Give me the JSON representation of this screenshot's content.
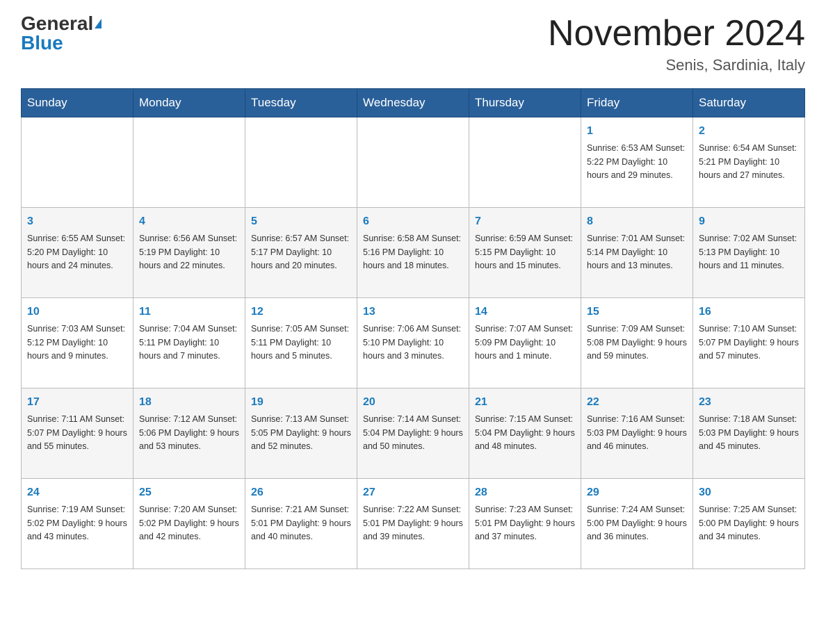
{
  "header": {
    "logo_general": "General",
    "logo_blue": "Blue",
    "month_title": "November 2024",
    "location": "Senis, Sardinia, Italy"
  },
  "days_of_week": [
    "Sunday",
    "Monday",
    "Tuesday",
    "Wednesday",
    "Thursday",
    "Friday",
    "Saturday"
  ],
  "weeks": [
    [
      {
        "day": "",
        "info": ""
      },
      {
        "day": "",
        "info": ""
      },
      {
        "day": "",
        "info": ""
      },
      {
        "day": "",
        "info": ""
      },
      {
        "day": "",
        "info": ""
      },
      {
        "day": "1",
        "info": "Sunrise: 6:53 AM\nSunset: 5:22 PM\nDaylight: 10 hours\nand 29 minutes."
      },
      {
        "day": "2",
        "info": "Sunrise: 6:54 AM\nSunset: 5:21 PM\nDaylight: 10 hours\nand 27 minutes."
      }
    ],
    [
      {
        "day": "3",
        "info": "Sunrise: 6:55 AM\nSunset: 5:20 PM\nDaylight: 10 hours\nand 24 minutes."
      },
      {
        "day": "4",
        "info": "Sunrise: 6:56 AM\nSunset: 5:19 PM\nDaylight: 10 hours\nand 22 minutes."
      },
      {
        "day": "5",
        "info": "Sunrise: 6:57 AM\nSunset: 5:17 PM\nDaylight: 10 hours\nand 20 minutes."
      },
      {
        "day": "6",
        "info": "Sunrise: 6:58 AM\nSunset: 5:16 PM\nDaylight: 10 hours\nand 18 minutes."
      },
      {
        "day": "7",
        "info": "Sunrise: 6:59 AM\nSunset: 5:15 PM\nDaylight: 10 hours\nand 15 minutes."
      },
      {
        "day": "8",
        "info": "Sunrise: 7:01 AM\nSunset: 5:14 PM\nDaylight: 10 hours\nand 13 minutes."
      },
      {
        "day": "9",
        "info": "Sunrise: 7:02 AM\nSunset: 5:13 PM\nDaylight: 10 hours\nand 11 minutes."
      }
    ],
    [
      {
        "day": "10",
        "info": "Sunrise: 7:03 AM\nSunset: 5:12 PM\nDaylight: 10 hours\nand 9 minutes."
      },
      {
        "day": "11",
        "info": "Sunrise: 7:04 AM\nSunset: 5:11 PM\nDaylight: 10 hours\nand 7 minutes."
      },
      {
        "day": "12",
        "info": "Sunrise: 7:05 AM\nSunset: 5:11 PM\nDaylight: 10 hours\nand 5 minutes."
      },
      {
        "day": "13",
        "info": "Sunrise: 7:06 AM\nSunset: 5:10 PM\nDaylight: 10 hours\nand 3 minutes."
      },
      {
        "day": "14",
        "info": "Sunrise: 7:07 AM\nSunset: 5:09 PM\nDaylight: 10 hours\nand 1 minute."
      },
      {
        "day": "15",
        "info": "Sunrise: 7:09 AM\nSunset: 5:08 PM\nDaylight: 9 hours\nand 59 minutes."
      },
      {
        "day": "16",
        "info": "Sunrise: 7:10 AM\nSunset: 5:07 PM\nDaylight: 9 hours\nand 57 minutes."
      }
    ],
    [
      {
        "day": "17",
        "info": "Sunrise: 7:11 AM\nSunset: 5:07 PM\nDaylight: 9 hours\nand 55 minutes."
      },
      {
        "day": "18",
        "info": "Sunrise: 7:12 AM\nSunset: 5:06 PM\nDaylight: 9 hours\nand 53 minutes."
      },
      {
        "day": "19",
        "info": "Sunrise: 7:13 AM\nSunset: 5:05 PM\nDaylight: 9 hours\nand 52 minutes."
      },
      {
        "day": "20",
        "info": "Sunrise: 7:14 AM\nSunset: 5:04 PM\nDaylight: 9 hours\nand 50 minutes."
      },
      {
        "day": "21",
        "info": "Sunrise: 7:15 AM\nSunset: 5:04 PM\nDaylight: 9 hours\nand 48 minutes."
      },
      {
        "day": "22",
        "info": "Sunrise: 7:16 AM\nSunset: 5:03 PM\nDaylight: 9 hours\nand 46 minutes."
      },
      {
        "day": "23",
        "info": "Sunrise: 7:18 AM\nSunset: 5:03 PM\nDaylight: 9 hours\nand 45 minutes."
      }
    ],
    [
      {
        "day": "24",
        "info": "Sunrise: 7:19 AM\nSunset: 5:02 PM\nDaylight: 9 hours\nand 43 minutes."
      },
      {
        "day": "25",
        "info": "Sunrise: 7:20 AM\nSunset: 5:02 PM\nDaylight: 9 hours\nand 42 minutes."
      },
      {
        "day": "26",
        "info": "Sunrise: 7:21 AM\nSunset: 5:01 PM\nDaylight: 9 hours\nand 40 minutes."
      },
      {
        "day": "27",
        "info": "Sunrise: 7:22 AM\nSunset: 5:01 PM\nDaylight: 9 hours\nand 39 minutes."
      },
      {
        "day": "28",
        "info": "Sunrise: 7:23 AM\nSunset: 5:01 PM\nDaylight: 9 hours\nand 37 minutes."
      },
      {
        "day": "29",
        "info": "Sunrise: 7:24 AM\nSunset: 5:00 PM\nDaylight: 9 hours\nand 36 minutes."
      },
      {
        "day": "30",
        "info": "Sunrise: 7:25 AM\nSunset: 5:00 PM\nDaylight: 9 hours\nand 34 minutes."
      }
    ]
  ]
}
